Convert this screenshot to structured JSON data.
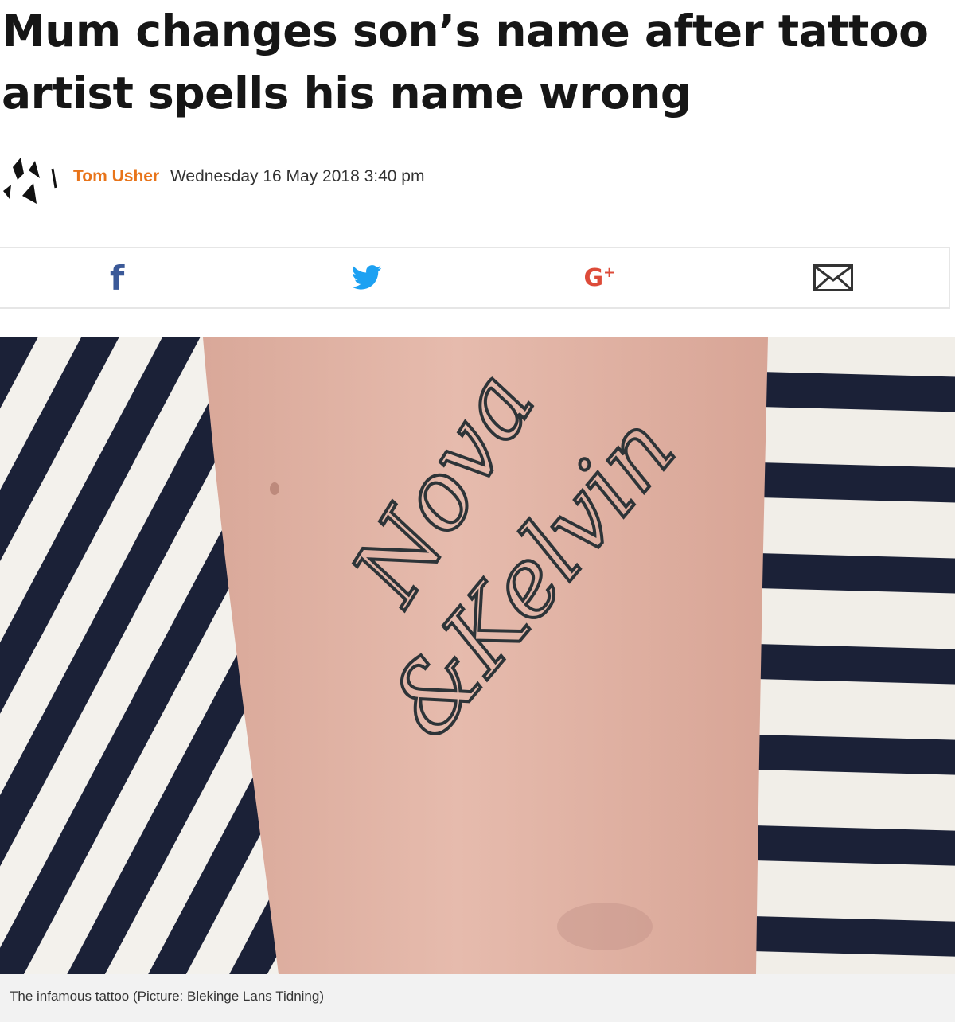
{
  "article": {
    "headline": "Mum changes son’s name after tattoo artist spells his name wrong",
    "author": "Tom Usher",
    "date": "Wednesday 16 May 2018 3:40 pm",
    "publisher_logo_icon": "metro-m-logo"
  },
  "share": {
    "facebook_icon": "facebook-icon",
    "twitter_icon": "twitter-icon",
    "googleplus_label": "G",
    "googleplus_plus": "+",
    "email_icon": "email-icon",
    "facebook_color": "#3b5998",
    "twitter_color": "#1da1f2",
    "googleplus_color": "#dd4b39"
  },
  "photo": {
    "tattoo_text_line1": "Nova",
    "tattoo_text_line2": "&Kelvin",
    "caption": "The infamous tattoo (Picture: Blekinge Lans Tidning)"
  },
  "colors": {
    "author": "#e8741a",
    "stripe": "#1b2137",
    "skin": "#e3b6a8"
  }
}
